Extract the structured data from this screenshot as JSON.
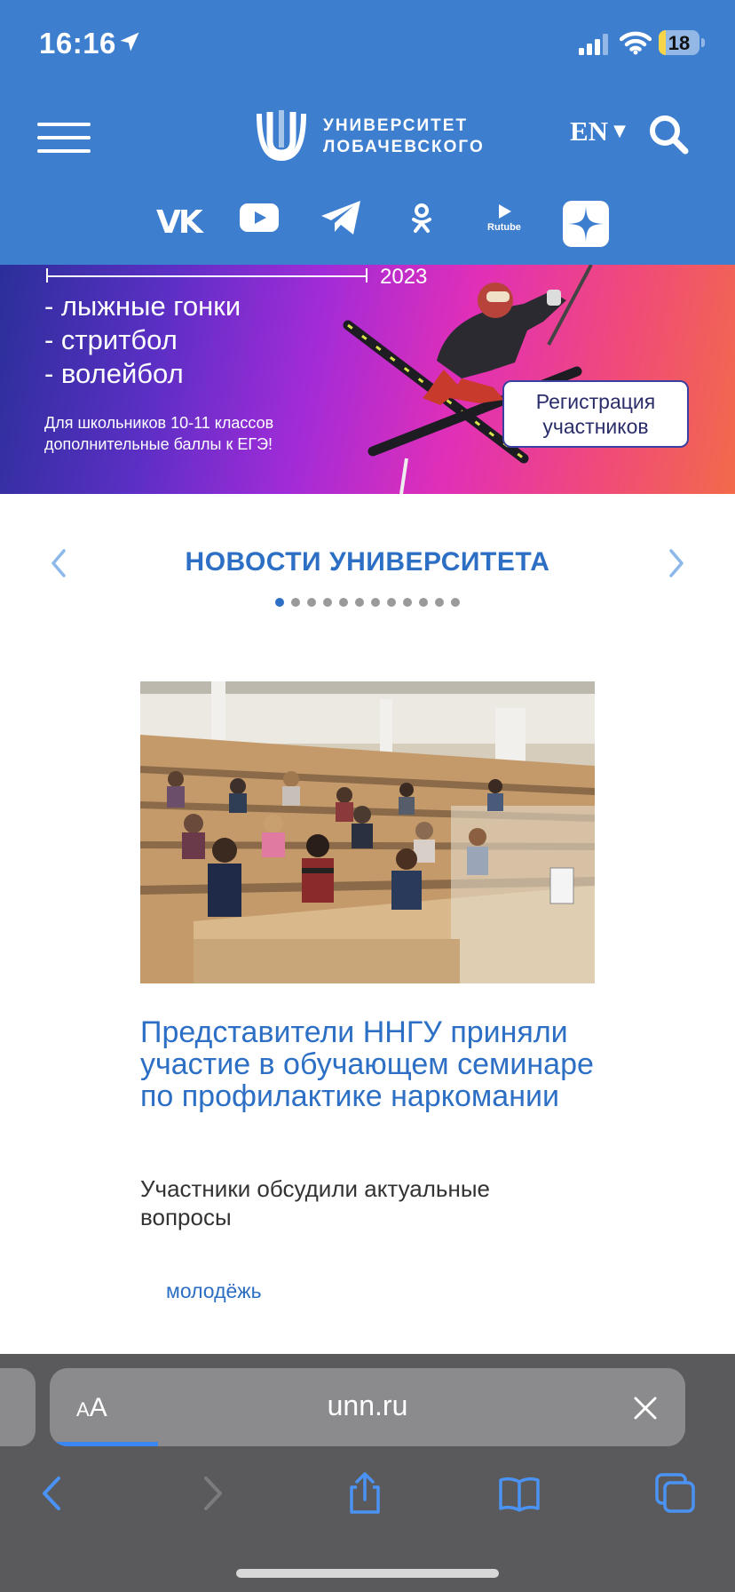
{
  "status_bar": {
    "time": "16:16",
    "battery": "18",
    "battery_level": 0.18
  },
  "header": {
    "logo_line1": "УНИВЕРСИТЕТ",
    "logo_line2": "ЛОБАЧЕВСКОГО",
    "language": "EN",
    "socials": [
      {
        "name": "vk",
        "label": "VK"
      },
      {
        "name": "youtube",
        "label": ""
      },
      {
        "name": "telegram",
        "label": ""
      },
      {
        "name": "odnoklassniki",
        "label": ""
      },
      {
        "name": "rutube",
        "label": "Rutube"
      },
      {
        "name": "dzen",
        "label": ""
      }
    ]
  },
  "banner": {
    "year": "2023",
    "items": [
      "- лыжные гонки",
      "- стритбол",
      "- волейбол"
    ],
    "note_line1": "Для школьников 10-11 классов",
    "note_line2": "дополнительные баллы к ЕГЭ!",
    "button_line1": "Регистрация",
    "button_line2": "участников"
  },
  "news": {
    "section_title": "НОВОСТИ УНИВЕРСИТЕТА",
    "dot_count": 12,
    "active_dot": 0,
    "headline": "Представители ННГУ приняли участие в обучающем семинаре по профилактике наркомании",
    "lead": "Участники обсудили актуальные вопросы",
    "tag": "молодёжь"
  },
  "browser": {
    "text_size_label": "AA",
    "url": "unn.ru",
    "load_progress": 0.17
  },
  "colors": {
    "header_bg": "#3d7ecf",
    "accent": "#2c6fc4",
    "browser_bg": "#5a5a5c"
  }
}
